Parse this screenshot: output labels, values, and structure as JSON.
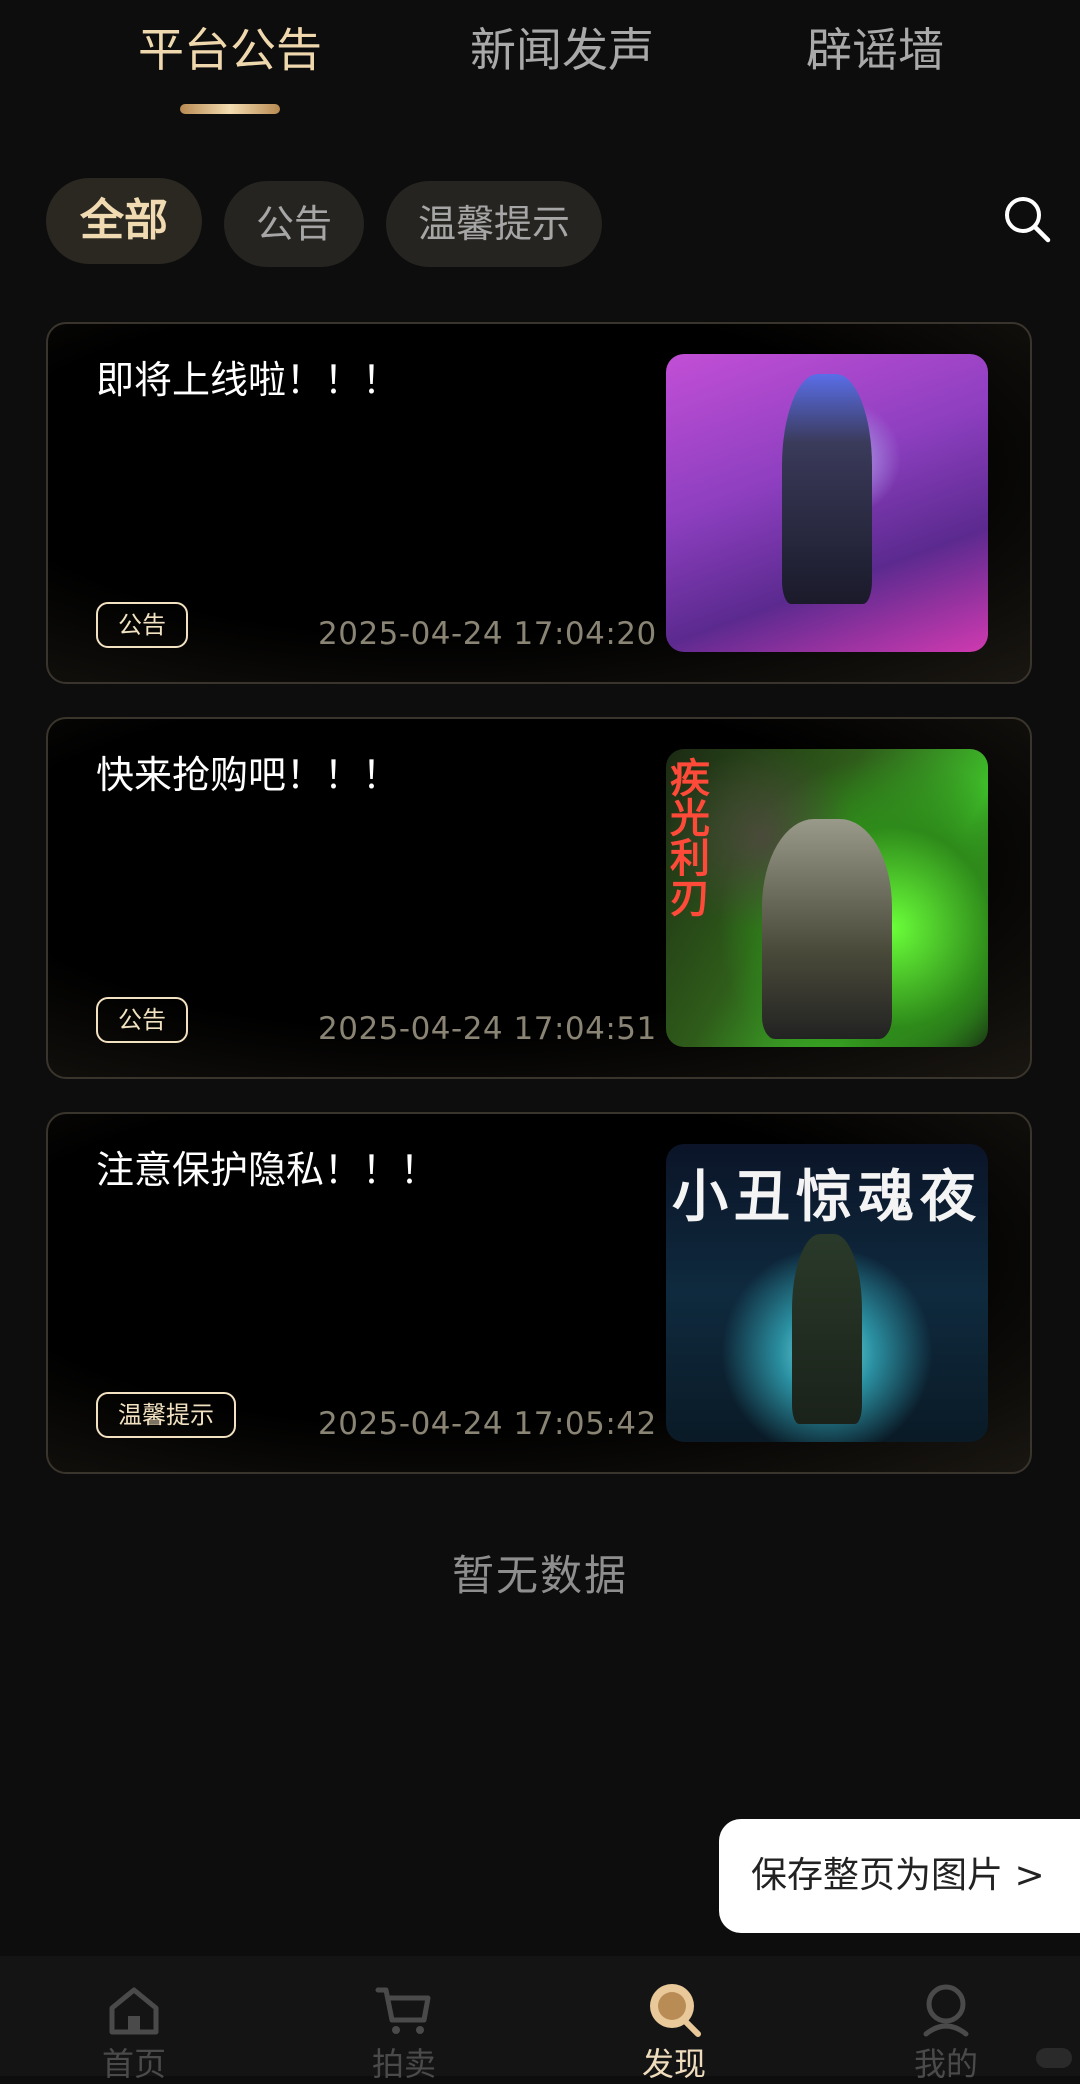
{
  "top_tabs": [
    {
      "label": "平台公告",
      "active": true
    },
    {
      "label": "新闻发声",
      "active": false
    },
    {
      "label": "辟谣墙",
      "active": false
    }
  ],
  "filters": [
    {
      "label": "全部",
      "active": true
    },
    {
      "label": "公告",
      "active": false
    },
    {
      "label": "温馨提示",
      "active": false
    }
  ],
  "search": {
    "icon": "search-icon"
  },
  "cards": [
    {
      "title": "即将上线啦！！！",
      "tag": "公告",
      "time": "2025-04-24 17:04:20"
    },
    {
      "title": "快来抢购吧！！！",
      "tag": "公告",
      "time": "2025-04-24 17:04:51",
      "thumb_text": "疾光利刃"
    },
    {
      "title": "注意保护隐私！！！",
      "tag": "温馨提示",
      "time": "2025-04-24 17:05:42",
      "thumb_text": "小丑惊魂夜"
    }
  ],
  "empty_text": "暂无数据",
  "save_button": "保存整页为图片 >",
  "bottom_nav": [
    {
      "label": "首页",
      "icon": "home-icon",
      "active": false
    },
    {
      "label": "拍卖",
      "icon": "cart-icon",
      "active": false
    },
    {
      "label": "发现",
      "icon": "discover-icon",
      "active": true
    },
    {
      "label": "我的",
      "icon": "profile-icon",
      "active": false
    }
  ],
  "colors": {
    "accent": "#f0d8ae",
    "background": "#0d0d0d",
    "card_border": "#3a352c",
    "time_text": "#8a8474"
  }
}
